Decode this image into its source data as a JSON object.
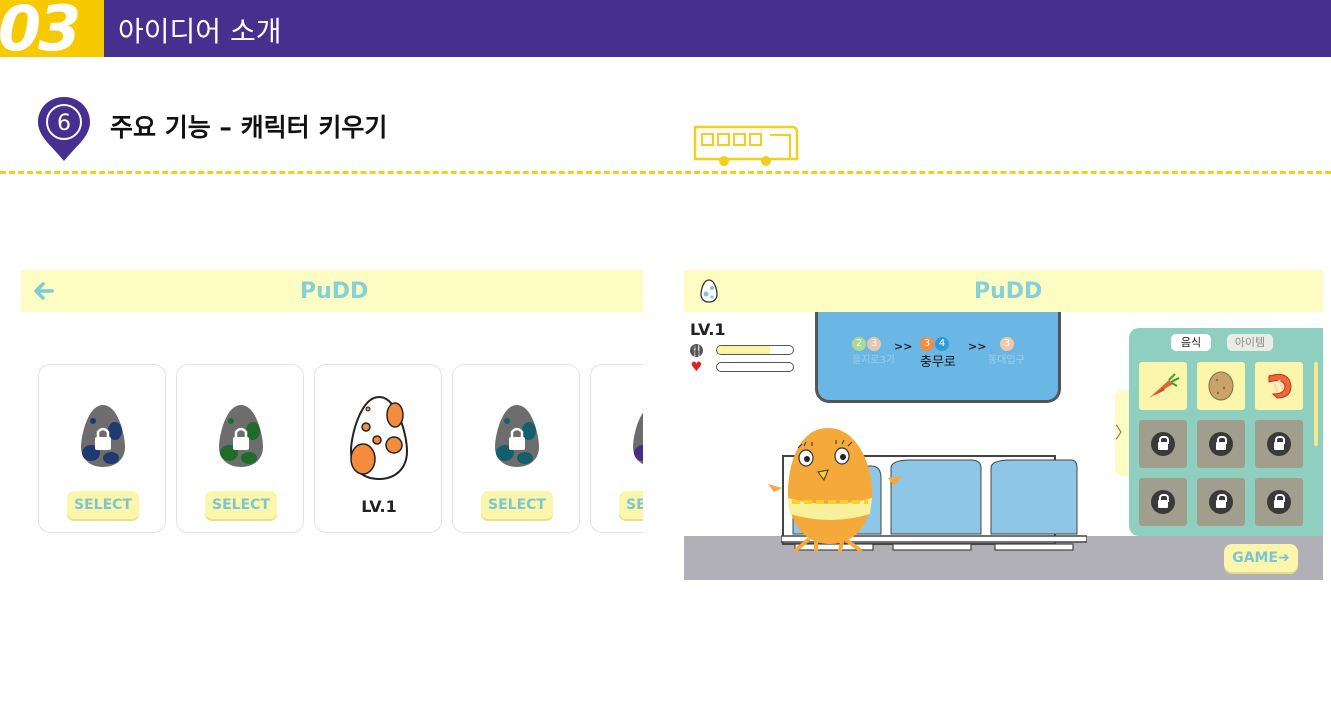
{
  "banner": {
    "section_number": "03",
    "title": "아이디어 소개"
  },
  "subheading": {
    "marker_number": "6",
    "title": "주요 기능 – 캐릭터 키우기"
  },
  "left_screen": {
    "back_icon": "back-arrow-icon",
    "logo": "PuDD",
    "cards": [
      {
        "state": "locked",
        "egg_color": "#1e3a6e",
        "label": "SELECT"
      },
      {
        "state": "locked",
        "egg_color": "#1f6b2a",
        "label": "SELECT"
      },
      {
        "state": "active",
        "egg_color": "#f58b3c",
        "label": "LV.1"
      },
      {
        "state": "locked",
        "egg_color": "#145f6b",
        "label": "SELECT"
      },
      {
        "state": "locked",
        "egg_color": "#4a2a85",
        "label": "SELECT"
      }
    ]
  },
  "right_screen": {
    "logo": "PuDD",
    "level": "LV.1",
    "stats": [
      {
        "icon": "food-icon",
        "fill": 0.7
      },
      {
        "icon": "heart-icon",
        "fill": 0.0
      }
    ],
    "subway_display": {
      "prev_station": {
        "lines": [
          "2",
          "3"
        ],
        "name": "을지로3가"
      },
      "separator": ">>",
      "current_station": {
        "lines": [
          "3",
          "4"
        ],
        "name": "충무로"
      },
      "next_station": {
        "lines": [
          "3"
        ],
        "name": "동대입구"
      }
    },
    "menu": {
      "tabs": [
        "음식",
        "아이템"
      ],
      "active_tab": "음식",
      "items": [
        {
          "type": "food",
          "icon": "carrot-icon"
        },
        {
          "type": "food",
          "icon": "potato-icon"
        },
        {
          "type": "food",
          "icon": "shrimp-icon"
        },
        {
          "type": "locked"
        },
        {
          "type": "locked"
        },
        {
          "type": "locked"
        },
        {
          "type": "locked"
        },
        {
          "type": "locked"
        },
        {
          "type": "locked"
        }
      ],
      "expand_icon": "chevron-right-icon"
    },
    "game_button": "GAME➜"
  },
  "colors": {
    "banner": "#46308f",
    "accent_yellow": "#f6c900",
    "logo": "#86d0d8",
    "menu_panel": "#8fcfbf"
  }
}
